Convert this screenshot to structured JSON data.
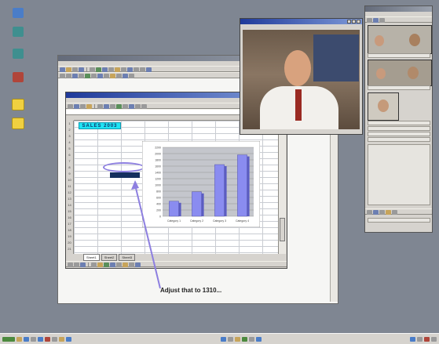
{
  "desktop": {
    "icons": [
      {
        "label": "",
        "icon": "computer-icon"
      },
      {
        "label": "",
        "icon": "network-icon"
      },
      {
        "label": "",
        "icon": "network-icon"
      },
      {
        "label": "",
        "icon": "tool-icon"
      },
      {
        "label": "",
        "icon": "folder-icon"
      },
      {
        "label": "",
        "icon": "folder-icon"
      }
    ]
  },
  "spreadsheet": {
    "sheet_title": "SALES 2003",
    "sheet_tabs": [
      "Sheet1",
      "Sheet2",
      "Sheet3"
    ]
  },
  "chart_data": {
    "type": "bar",
    "categories": [
      "Category 1",
      "Category 2",
      "Category 3",
      "Category 4"
    ],
    "series": [
      {
        "values": [
          480,
          780,
          1650,
          1960
        ]
      }
    ],
    "ylim": [
      0,
      2200
    ],
    "grid": true,
    "legend": "none"
  },
  "annotation": {
    "text": "Adjust that to 1310..."
  },
  "colors": {
    "desktop": "#7f8692",
    "bar": "#8a8cf0",
    "highlight": "#8d7fe0",
    "title_bar": "#1f3a9a"
  }
}
